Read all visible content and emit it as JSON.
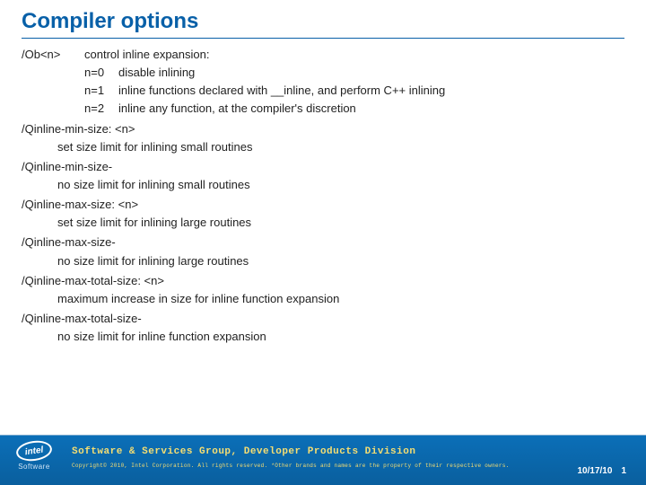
{
  "title": "Compiler options",
  "ob": {
    "flag": "/Ob<n>",
    "desc": "control inline expansion:",
    "rows": [
      {
        "key": "n=0",
        "text": "disable inlining"
      },
      {
        "key": "n=1",
        "text": "inline functions declared with __inline, and perform C++ inlining"
      },
      {
        "key": "n=2",
        "text": "inline any function, at the compiler's discretion"
      }
    ]
  },
  "flags": [
    {
      "flag": "/Qinline-min-size: <n>",
      "desc": "set size limit for inlining small routines"
    },
    {
      "flag": "/Qinline-min-size-",
      "desc": "no size limit for inlining small routines"
    },
    {
      "flag": "/Qinline-max-size: <n>",
      "desc": "set size limit for inlining large routines"
    },
    {
      "flag": "/Qinline-max-size-",
      "desc": "no size limit for inlining large routines"
    },
    {
      "flag": "/Qinline-max-total-size: <n>",
      "desc": "maximum increase in size for inline function expansion"
    },
    {
      "flag": "/Qinline-max-total-size-",
      "desc": "no size limit for inline function expansion"
    }
  ],
  "footer": {
    "logo": "intel",
    "logo_sub": "Software",
    "division": "Software & Services Group, Developer Products Division",
    "copyright": "Copyright© 2010, Intel Corporation. All rights reserved. *Other brands and names are the property of their respective owners.",
    "date": "10/17/10",
    "page": "1"
  }
}
